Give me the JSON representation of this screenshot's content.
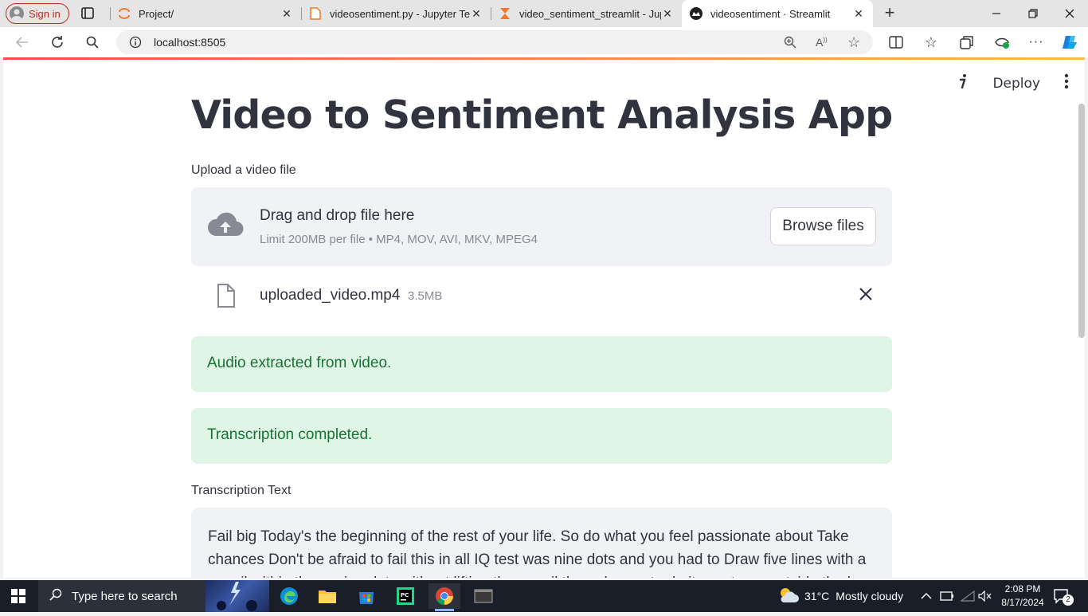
{
  "browser": {
    "signin_label": "Sign in",
    "tabs": [
      {
        "label": "Project/",
        "icon": "jupyter-icon"
      },
      {
        "label": "videosentiment.py - Jupyter Text",
        "icon": "file-icon"
      },
      {
        "label": "video_sentiment_streamlit - Jupy",
        "icon": "hourglass-icon"
      },
      {
        "label": "videosentiment · Streamlit",
        "icon": "streamlit-icon"
      }
    ],
    "url": "localhost:8505"
  },
  "app": {
    "deploy_label": "Deploy",
    "title": "Video to Sentiment Analysis App",
    "upload_label": "Upload a video file",
    "dropzone_title": "Drag and drop file here",
    "dropzone_limit": "Limit 200MB per file • MP4, MOV, AVI, MKV, MPEG4",
    "browse_label": "Browse files",
    "file_name": "uploaded_video.mp4",
    "file_size": "3.5MB",
    "alert_audio": "Audio extracted from video.",
    "alert_transcription": "Transcription completed.",
    "transcription_label": "Transcription Text",
    "transcription_text": "Fail big Today's the beginning of the rest of your life. So do what you feel passionate about Take chances Don't be afraid to fail this in all IQ test was nine dots and you had to Draw five lines with a pencil within these nine dots without lifting the pencil the only way to do it was to go outside the bo"
  },
  "taskbar": {
    "search_placeholder": "Type here to search",
    "weather_temp": "31°C",
    "weather_desc": "Mostly cloudy",
    "time": "2:08 PM",
    "date": "8/17/2024",
    "notification_count": "2"
  }
}
